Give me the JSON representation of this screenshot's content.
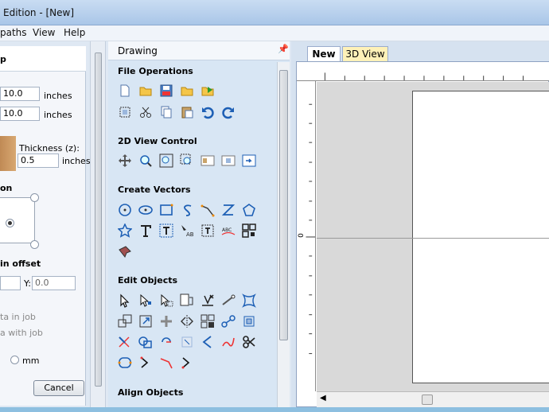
{
  "window": {
    "title": "Edition - [New]"
  },
  "menu": {
    "items": [
      "paths",
      "View",
      "Help"
    ]
  },
  "left_panel": {
    "header": "p",
    "width_value": "10.0",
    "height_value": "10.0",
    "units_label": "inches",
    "thickness_label": "Thickness (z):",
    "thickness_value": "0.5",
    "thickness_units": "inches",
    "origin_section": "on",
    "offset_section": "in offset",
    "x_value": "",
    "y_label": "Y:",
    "y_value": "0.0",
    "hint1": "ta in job",
    "hint2": "a with job",
    "mm_label": "mm",
    "cancel_label": "Cancel"
  },
  "drawing_panel": {
    "title": "Drawing",
    "pin": "↑",
    "sections": {
      "file_operations": "File Operations",
      "view_control": "2D View Control",
      "create_vectors": "Create Vectors",
      "edit_objects": "Edit Objects",
      "align_objects": "Align Objects"
    }
  },
  "view": {
    "tabs": [
      "New",
      "3D View"
    ],
    "ruler_zero": "0"
  },
  "colors": {
    "panel_bg": "#d8e6f4",
    "accent_blue": "#1d5fb5",
    "tab_3d": "#fef1b8"
  }
}
